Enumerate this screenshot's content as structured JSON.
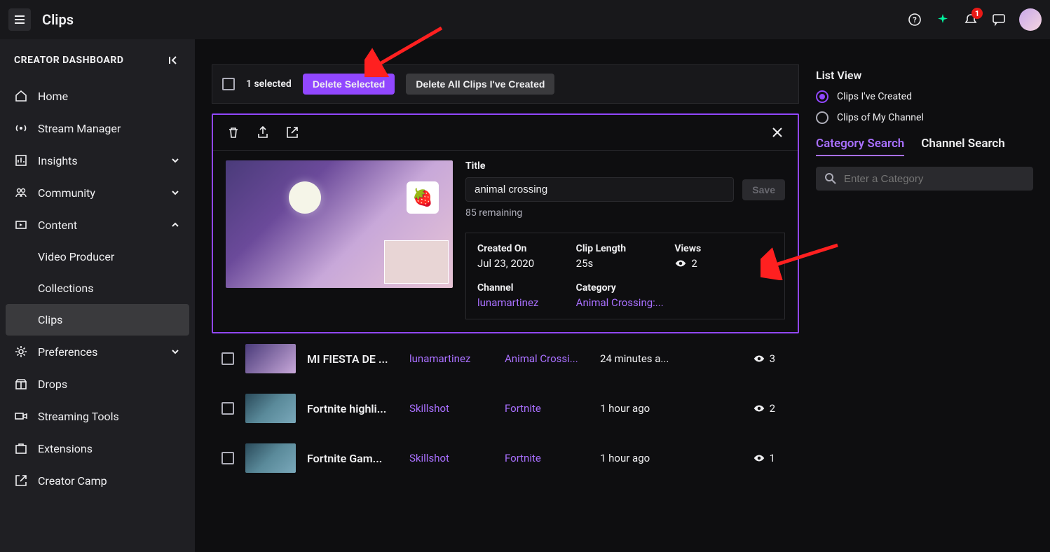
{
  "header": {
    "title": "Clips",
    "notifications_count": "1"
  },
  "sidebar": {
    "heading": "CREATOR DASHBOARD",
    "home": "Home",
    "stream_manager": "Stream Manager",
    "insights": "Insights",
    "community": "Community",
    "content": "Content",
    "video_producer": "Video Producer",
    "collections": "Collections",
    "clips": "Clips",
    "preferences": "Preferences",
    "drops": "Drops",
    "streaming_tools": "Streaming Tools",
    "extensions": "Extensions",
    "creator_camp": "Creator Camp"
  },
  "actionbar": {
    "selected_count": "1 selected",
    "delete_selected": "Delete Selected",
    "delete_all": "Delete All Clips I've Created"
  },
  "detail": {
    "title_label": "Title",
    "title_value": "animal crossing",
    "save_label": "Save",
    "remaining": "85 remaining",
    "created_on_label": "Created On",
    "created_on_value": "Jul 23, 2020",
    "clip_length_label": "Clip Length",
    "clip_length_value": "25s",
    "views_label": "Views",
    "views_value": "2",
    "channel_label": "Channel",
    "channel_value": "lunamartinez",
    "category_label": "Category",
    "category_value": "Animal Crossing:..."
  },
  "rows": [
    {
      "title": "MI FIESTA DE ...",
      "channel": "lunamartinez",
      "category": "Animal Crossi...",
      "time": "24 minutes a...",
      "views": "3",
      "thumbclass": ""
    },
    {
      "title": "Fortnite highli...",
      "channel": "Skillshot",
      "category": "Fortnite",
      "time": "1 hour ago",
      "views": "2",
      "thumbclass": "fortnite"
    },
    {
      "title": "Fortnite Gam...",
      "channel": "Skillshot",
      "category": "Fortnite",
      "time": "1 hour ago",
      "views": "1",
      "thumbclass": "fortnite"
    }
  ],
  "right": {
    "list_view": "List View",
    "created": "Clips I've Created",
    "channel": "Clips of My Channel",
    "category_search": "Category Search",
    "channel_search": "Channel Search",
    "search_placeholder": "Enter a Category"
  }
}
